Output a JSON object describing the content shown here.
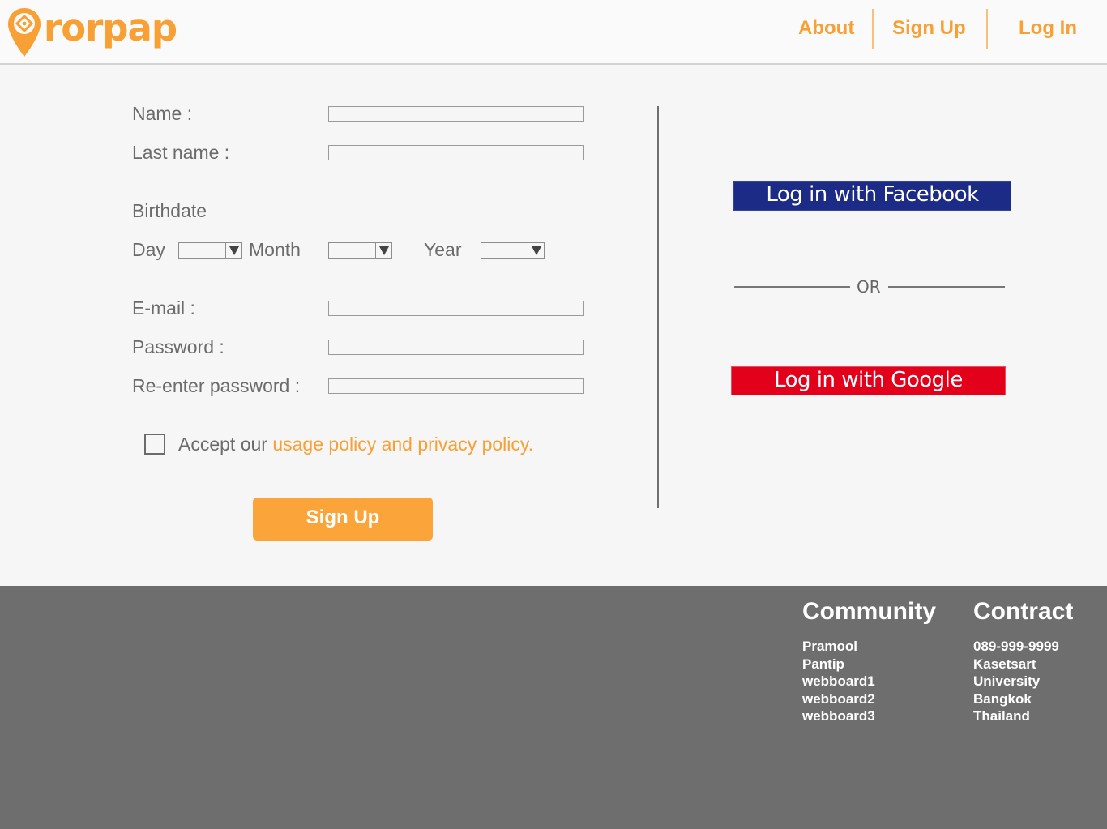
{
  "brand": {
    "name": "rorpap",
    "accent": "#f8a034"
  },
  "nav": {
    "about": "About",
    "signup": "Sign Up",
    "login": "Log In"
  },
  "form": {
    "name_label": "Name :",
    "lastname_label": "Last name :",
    "birthdate_label": "Birthdate",
    "day_label": "Day",
    "month_label": "Month",
    "year_label": "Year",
    "email_label": "E-mail :",
    "password_label": "Password :",
    "reenter_label": "Re-enter password :",
    "accept_text": "Accept our ",
    "policy_link": "usage policy and privacy policy.",
    "signup_button": "Sign Up"
  },
  "social": {
    "facebook": "Log in with Facebook",
    "facebook_color": "#1c2b85",
    "or": "OR",
    "google": "Log in with Google",
    "google_color": "#e3001b"
  },
  "footer": {
    "community_title": "Community",
    "community_items": [
      "Pramool",
      "Pantip",
      "webboard1",
      "webboard2",
      "webboard3"
    ],
    "contract_title": "Contract",
    "contract_items": [
      "089-999-9999",
      "Kasetsart",
      "University",
      "Bangkok",
      "Thailand"
    ]
  }
}
